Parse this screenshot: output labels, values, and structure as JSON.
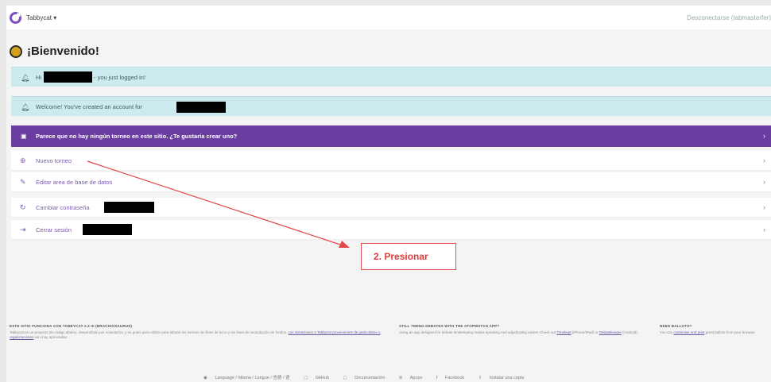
{
  "topbar": {
    "brand": "Tabbycat ▾",
    "logout": "Desconectarse (tabmasterfer)"
  },
  "welcome": {
    "title": "¡Bienvenido!"
  },
  "alerts": [
    {
      "prefix": "Hi",
      "suffix": "- you just logged in!"
    },
    {
      "prefix": "Welcome! You've created an account for"
    }
  ],
  "no_tournament": {
    "text": "Parece que no hay ningún torneo en este sitio. ¿Te gustaría crear uno?"
  },
  "menu": {
    "new_tournament": "Nuevo torneo",
    "edit_db": "Editar area de base de datos",
    "change_password": "Cambiar contraseña",
    "logout": "Cerrar sesión"
  },
  "annotation": {
    "label": "2. Presionar"
  },
  "footer": {
    "col1_title": "ESTE SITIO FUNCIONA CON TABBYCAT 2.3 III (BRACHIOSAURUS)",
    "col1_text": "Tabbycat es un proyecto de código abierto, desarrollado por voluntarios, y es gratis para utilizar para tabular los torneos sin fines de lucro y sin fines de recaudación de fondos.",
    "col1_link": "Las donaciones a Tabbycat provenientes de particulares u organizaciones",
    "col1_tail": "son muy apreciadas.",
    "col2_title": "STILL TIMING DEBATES WITH THE STOPWATCH APP?",
    "col2_text": "Using an app designed for debate timekeeping makes speaking and adjudicating easier! Check out",
    "col2_link1": "Timekept",
    "col2_mid": "(iPhone/iPad) or",
    "col2_link2": "Debatekeeper",
    "col2_tail": "(Android).",
    "col3_title": "NEED BALLOTS?",
    "col3_text": "You can",
    "col3_link": "customise and print",
    "col3_tail": "great ballots from your browser"
  },
  "bottom_links": {
    "language": "Language / Idioma / Langue / 言語 / 语",
    "github": "GitHub",
    "docs": "Documentación",
    "support": "Apoyo",
    "facebook": "Facebook",
    "install": "Instalar una copia"
  },
  "colors": {
    "purple": "#6a3da0",
    "alert_bg": "#cdebef",
    "annotation": "#e23a3a"
  },
  "icons": [
    "tabbycat-logo-icon",
    "cat-face-icon",
    "bell-icon",
    "info-icon",
    "plus-circle-icon",
    "edit-icon",
    "refresh-icon",
    "logout-icon",
    "chevron-right-icon"
  ]
}
